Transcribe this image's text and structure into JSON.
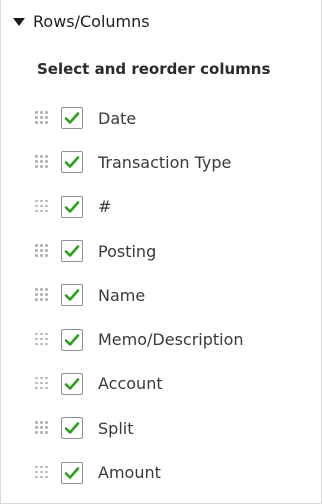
{
  "section": {
    "title": "Rows/Columns",
    "expanded": true
  },
  "subheading": "Select and reorder columns",
  "colors": {
    "check": "#2ca01c",
    "checkbox_border": "#8d9096",
    "text": "#393a3d"
  },
  "columns": [
    {
      "label": "Date",
      "checked": true
    },
    {
      "label": "Transaction Type",
      "checked": true
    },
    {
      "label": "#",
      "checked": true
    },
    {
      "label": "Posting",
      "checked": true
    },
    {
      "label": "Name",
      "checked": true
    },
    {
      "label": "Memo/Description",
      "checked": true
    },
    {
      "label": "Account",
      "checked": true
    },
    {
      "label": "Split",
      "checked": true
    },
    {
      "label": "Amount",
      "checked": true
    }
  ]
}
